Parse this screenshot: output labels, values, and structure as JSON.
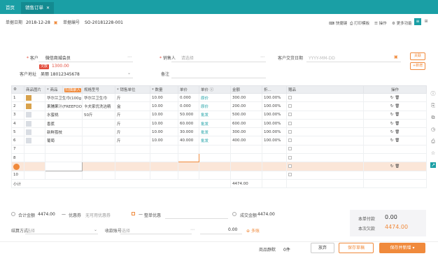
{
  "colors": {
    "brand": "#1a9fa5",
    "accent": "#f08a3c",
    "danger": "#e24b3b"
  },
  "tabs": [
    {
      "label": "首页"
    },
    {
      "label": "销售订单"
    }
  ],
  "header": {
    "date_label": "单据日期",
    "date_value": "2018-12-28",
    "no_label": "单据编号",
    "no_value": "SO-20181228-001",
    "toolbar": [
      "快捷键",
      "打印模板",
      "操作",
      "更多功能"
    ]
  },
  "form": {
    "customer_label": "客户",
    "customer_value": "微信商城会员",
    "customer_badge": "欠款",
    "customer_balance": "1300.00",
    "salesman_label": "销售人",
    "salesman_value": "请选择",
    "delivery_label": "客户交货日期",
    "delivery_value": "YYYY-MM-DD",
    "address_label": "客户地址",
    "address_value": "吴丽 18012345678",
    "remark_label": "备注",
    "remark_value": "",
    "side_buttons": [
      "关联",
      "+新增"
    ]
  },
  "table": {
    "headers": [
      "序号",
      "商品图片",
      "* 商品",
      "扫描录入",
      "规格型号",
      "* 销售单位",
      "* 数量",
      "单价",
      "单价",
      "金额",
      "折...",
      "赠品",
      "操作"
    ],
    "rows": [
      {
        "no": "1",
        "img": "food",
        "name": "华尔兰卫生巾(100g 奇...",
        "spec": "华尔兰卫生巾",
        "unit": "斤",
        "qty": "10.00",
        "price": "0.000",
        "tag": "原价",
        "amount": "300.00",
        "disc": "100.00%"
      },
      {
        "no": "2",
        "img": "food",
        "name": "果脯果汁(FREEFOOD)(可...",
        "spec": "卡夫家优洗洁精",
        "unit": "盒",
        "qty": "10.00",
        "price": "0.000",
        "tag": "原价",
        "amount": "200.00",
        "disc": "100.00%"
      },
      {
        "no": "3",
        "img": "blank",
        "name": "水蜜桃",
        "spec": "50斤",
        "unit": "斤",
        "qty": "10.00",
        "price": "50.000",
        "tag": "批发",
        "amount": "500.00",
        "disc": "100.00%"
      },
      {
        "no": "4",
        "img": "blank",
        "name": "香蕉",
        "spec": "",
        "unit": "斤",
        "qty": "10.00",
        "price": "60.000",
        "tag": "批发",
        "amount": "600.00",
        "disc": "100.00%"
      },
      {
        "no": "5",
        "img": "blank",
        "name": "新鲜荔枝",
        "spec": "",
        "unit": "斤",
        "qty": "10.00",
        "price": "30.000",
        "tag": "批发",
        "amount": "300.00",
        "disc": "100.00%"
      },
      {
        "no": "6",
        "img": "blank",
        "name": "葡萄",
        "spec": "",
        "unit": "斤",
        "qty": "10.00",
        "price": "40.000",
        "tag": "批发",
        "amount": "400.00",
        "disc": "100.00%"
      },
      {
        "no": "7",
        "img": "",
        "name": "",
        "spec": "",
        "unit": "",
        "qty": "",
        "price": "",
        "tag": "",
        "amount": "",
        "disc": ""
      },
      {
        "no": "8",
        "img": "",
        "name": "",
        "spec": "",
        "unit": "",
        "qty": "",
        "price": "",
        "tag": "",
        "amount": "",
        "disc": ""
      },
      {
        "no": "",
        "img": "",
        "name": "",
        "spec": "",
        "unit": "",
        "qty": "",
        "price": "",
        "tag": "",
        "amount": "",
        "disc": ""
      },
      {
        "no": "10",
        "img": "",
        "name": "",
        "spec": "",
        "unit": "",
        "qty": "",
        "price": "",
        "tag": "",
        "amount": "",
        "disc": ""
      }
    ],
    "total_label": "小计",
    "total_amount": "4474.00"
  },
  "footer": {
    "total_label": "合计金额",
    "total_value": "4474.00",
    "discount_label": "优惠券",
    "coupon_value": "无可用优惠券",
    "whole_discount_label": "整单优惠",
    "deal_label": "成交金额",
    "deal_value": "4474.00",
    "settle_label": "结算方式",
    "settle_placeholder": "选择",
    "account_label": "收款账号",
    "account_placeholder": "选择",
    "amount_value": "0.00",
    "more_label": "多账",
    "paid_label": "本单付款",
    "paid_value": "0.00",
    "owe_label": "本次欠款",
    "owe_value": "4474.00"
  },
  "bottom": {
    "print_label": "商品静默",
    "print_value": "0件",
    "cancel": "放弃",
    "save": "保存草稿",
    "submit": "保存并新增"
  }
}
